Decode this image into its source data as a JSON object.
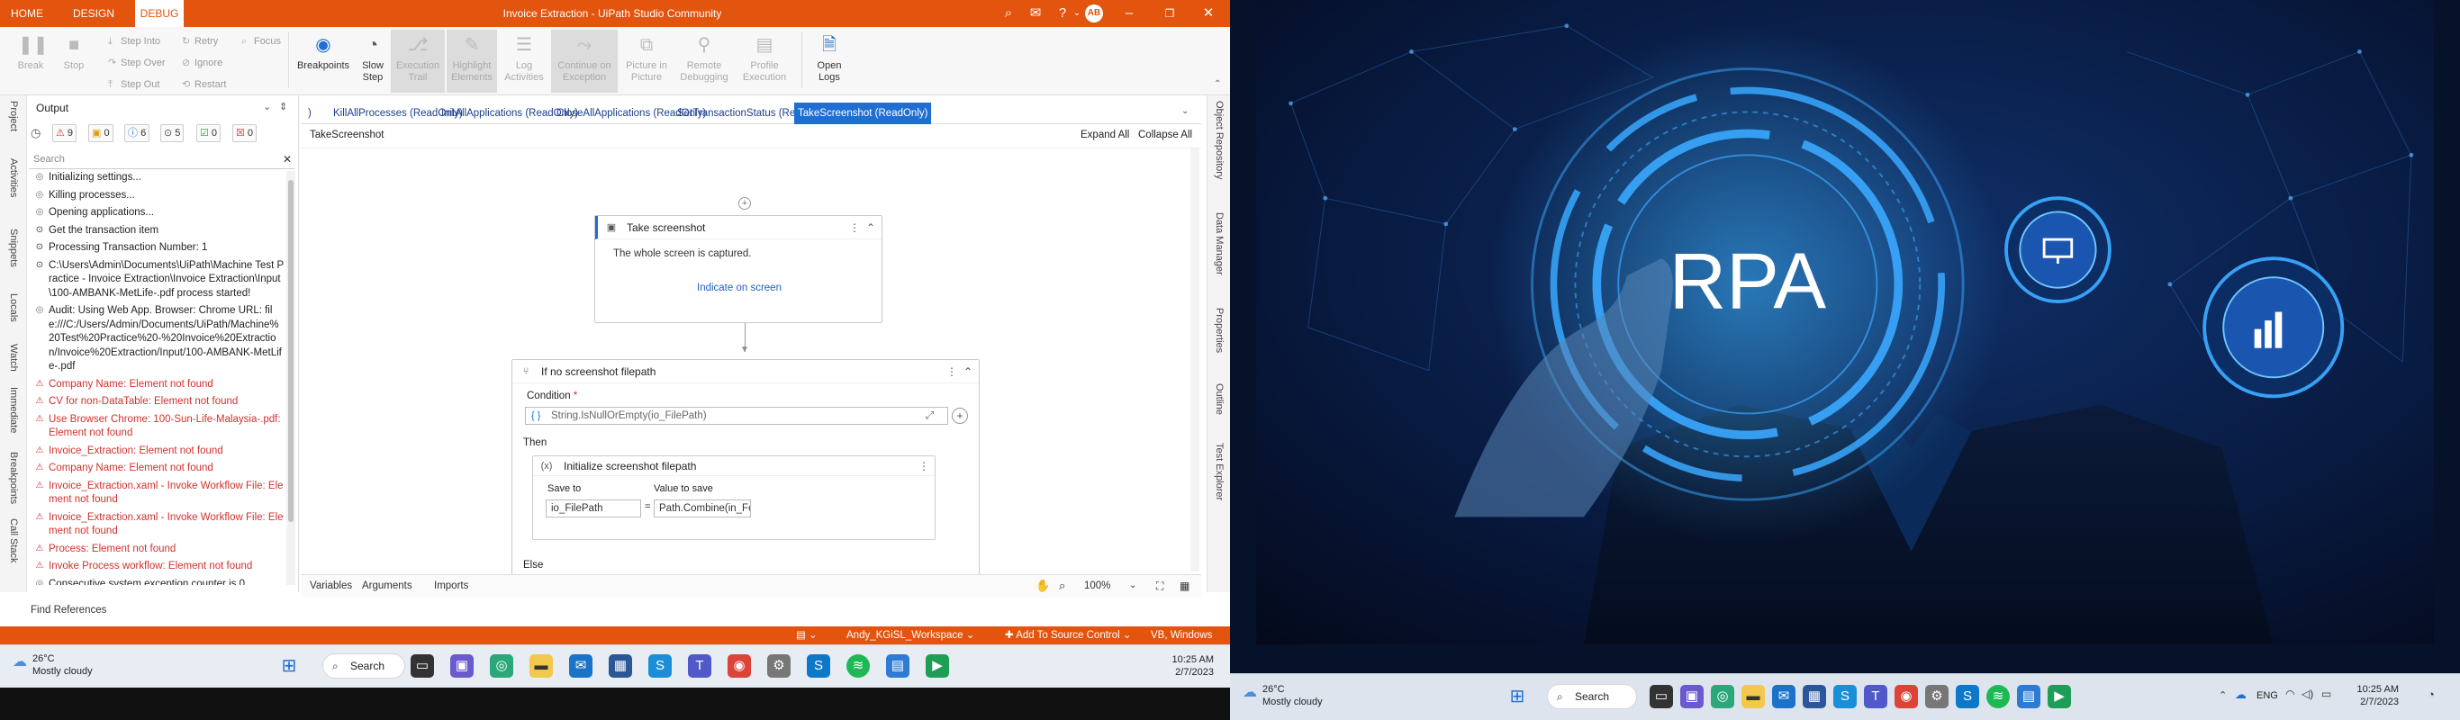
{
  "left": {
    "titlebar": {
      "tabs": [
        "HOME",
        "DESIGN",
        "DEBUG"
      ],
      "active_tab": "DEBUG",
      "app_title": "Invoice Extraction - UiPath Studio Community",
      "user_initials": "AB"
    },
    "ribbon": {
      "break": "Break",
      "stop": "Stop",
      "step_into": "Step Into",
      "step_over": "Step Over",
      "step_out": "Step Out",
      "retry": "Retry",
      "ignore": "Ignore",
      "restart": "Restart",
      "focus": "Focus",
      "breakpoints": "Breakpoints",
      "slow_step_1": "Slow",
      "slow_step_2": "Step",
      "exec_trail_1": "Execution",
      "exec_trail_2": "Trail",
      "highlight_1": "Highlight",
      "highlight_2": "Elements",
      "log_act_1": "Log",
      "log_act_2": "Activities",
      "continue_exc_1": "Continue on",
      "continue_exc_2": "Exception",
      "pip_1": "Picture in",
      "pip_2": "Picture",
      "remote_1": "Remote",
      "remote_2": "Debugging",
      "profile_1": "Profile",
      "profile_2": "Execution",
      "open_logs_1": "Open",
      "open_logs_2": "Logs"
    },
    "left_vtabs": [
      "Project",
      "Activities",
      "Snippets",
      "Locals",
      "Watch",
      "Immediate",
      "Breakpoints",
      "Call Stack"
    ],
    "output": {
      "title": "Output",
      "filters": [
        "9",
        "0",
        "6",
        "5",
        "0",
        "0"
      ],
      "search_placeholder": "Search",
      "logs": [
        {
          "text": "Initializing settings...",
          "level": "info"
        },
        {
          "text": "Killing processes...",
          "level": "info"
        },
        {
          "text": "Opening applications...",
          "level": "info"
        },
        {
          "text": "Get the transaction item",
          "level": "trace"
        },
        {
          "text": "Processing Transaction Number: 1",
          "level": "trace"
        },
        {
          "text": "C:\\Users\\Admin\\Documents\\UiPath\\Machine Test Practice - Invoice Extraction\\Invoice Extraction\\Input\\100-AMBANK-MetLife-.pdf process started!",
          "level": "trace"
        },
        {
          "text": "Audit: Using Web App. Browser: Chrome URL: file:///C:/Users/Admin/Documents/UiPath/Machine%20Test%20Practice%20-%20Invoice%20Extraction/Invoice%20Extraction/Input/100-AMBANK-MetLife-.pdf",
          "level": "info"
        },
        {
          "text": "Company Name: Element not found",
          "level": "error"
        },
        {
          "text": "CV for non-DataTable: Element not found",
          "level": "error"
        },
        {
          "text": "Use Browser Chrome: 100-Sun-Life-Malaysia-.pdf: Element not found",
          "level": "error"
        },
        {
          "text": "Invoice_Extraction: Element not found",
          "level": "error"
        },
        {
          "text": "Company Name: Element not found",
          "level": "error"
        },
        {
          "text": "Invoice_Extraction.xaml - Invoke Workflow File: Element not found",
          "level": "error"
        },
        {
          "text": "Invoice_Extraction.xaml - Invoke Workflow File: Element not found",
          "level": "error"
        },
        {
          "text": "Process: Element not found",
          "level": "error"
        },
        {
          "text": "Invoke Process workflow: Element not found",
          "level": "error"
        },
        {
          "text": "Consecutive system exception counter is 0.",
          "level": "info"
        }
      ],
      "find_references": "Find References"
    },
    "designer": {
      "doc_tabs": [
        ")",
        "KillAllProcesses (ReadOnly)",
        "InitAllApplications (ReadOnly)",
        "CloseAllApplications (ReadOnly)",
        "SetTransactionStatus (ReadOnly)",
        "TakeScreenshot (ReadOnly)"
      ],
      "active_doc_tab": "TakeScreenshot (ReadOnly)",
      "breadcrumb": "TakeScreenshot",
      "expand_all": "Expand All",
      "collapse_all": "Collapse All",
      "take_screenshot": {
        "title": "Take screenshot",
        "desc": "The whole screen is captured.",
        "link": "Indicate on screen"
      },
      "if_block": {
        "title": "If no screenshot filepath",
        "condition_label": "Condition",
        "condition_required": "*",
        "condition_value": "String.IsNullOrEmpty(io_FilePath)",
        "then_label": "Then",
        "else_label": "Else",
        "assign_title": "Initialize screenshot filepath",
        "save_to_label": "Save to",
        "value_label": "Value to save",
        "save_to_value": "io_FilePath",
        "value_value": "Path.Combine(in_Folder, \"Excepti",
        "equals": "="
      },
      "footer_tabs": [
        "Variables",
        "Arguments",
        "Imports"
      ],
      "zoom": "100%"
    },
    "right_vtabs": [
      "Object Repository",
      "Data Manager",
      "Properties",
      "Outline",
      "Test Explorer"
    ],
    "statusbar": {
      "workspace": "Andy_KGiSL_Workspace",
      "source_control": "Add To Source Control",
      "target": "VB, Windows"
    },
    "taskbar": {
      "temp": "26°C",
      "weather": "Mostly cloudy",
      "search": "Search",
      "time": "10:25 AM",
      "date": "2/7/2023"
    }
  },
  "right": {
    "hero_text": "RPA",
    "taskbar": {
      "temp": "26°C",
      "weather": "Mostly cloudy",
      "search": "Search",
      "lang": "ENG",
      "time": "10:25 AM",
      "date": "2/7/2023"
    }
  },
  "colors": {
    "uipath_orange": "#e3540e",
    "tab_blue": "#1f6ed1",
    "error_red": "#d0312d",
    "hero_bg": "#06112a",
    "hero_glow": "#1ea0ff"
  }
}
